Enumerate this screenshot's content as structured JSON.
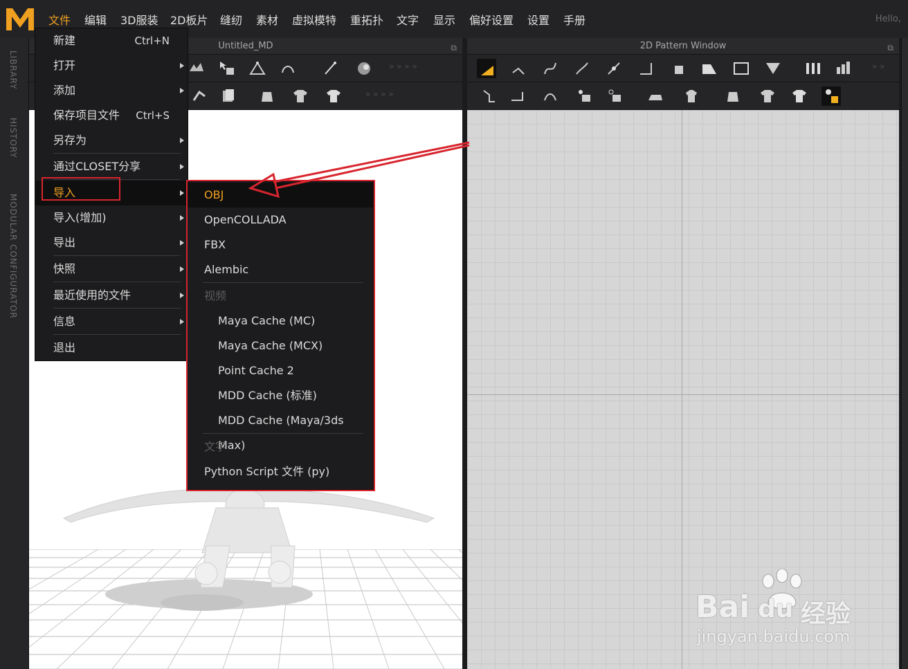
{
  "menubar": {
    "items": [
      "文件",
      "编辑",
      "3D服装",
      "2D板片",
      "缝纫",
      "素材",
      "虚拟模特",
      "重拓扑",
      "文字",
      "显示",
      "偏好设置",
      "设置",
      "手册"
    ],
    "hello": "Hello,"
  },
  "side_tabs": [
    "LIBRARY",
    "HISTORY",
    "MODULAR CONFIGURATOR"
  ],
  "panels": {
    "left_title": "Untitled_MD",
    "right_title": "2D Pattern Window"
  },
  "file_menu": {
    "items": [
      {
        "label": "新建",
        "shortcut": "Ctrl+N"
      },
      {
        "label": "打开",
        "submenu": true
      },
      {
        "label": "添加",
        "submenu": true
      },
      {
        "label": "保存项目文件",
        "shortcut": "Ctrl+S"
      },
      {
        "label": "另存为",
        "submenu": true
      },
      {
        "label": "通过CLOSET分享",
        "submenu": true
      },
      {
        "label": "导入",
        "submenu": true,
        "highlighted": true
      },
      {
        "label": "导入(增加)",
        "submenu": true
      },
      {
        "label": "导出",
        "submenu": true
      },
      {
        "label": "快照",
        "submenu": true
      },
      {
        "label": "最近使用的文件",
        "submenu": true
      },
      {
        "label": "信息",
        "submenu": true
      },
      {
        "label": "退出"
      }
    ]
  },
  "import_submenu": {
    "items": [
      {
        "label": "OBJ",
        "highlighted": true
      },
      {
        "label": "OpenCOLLADA"
      },
      {
        "label": "FBX"
      },
      {
        "label": "Alembic"
      },
      {
        "label": "视频",
        "group": true
      },
      {
        "label": "Maya Cache (MC)",
        "indent": true
      },
      {
        "label": "Maya Cache (MCX)",
        "indent": true
      },
      {
        "label": "Point Cache 2",
        "indent": true
      },
      {
        "label": "MDD Cache (标准)",
        "indent": true
      },
      {
        "label": "MDD Cache (Maya/3ds Max)",
        "indent": true
      },
      {
        "label": "文字",
        "group": true
      },
      {
        "label": "Python  Script 文件 (py)"
      }
    ]
  },
  "watermark": {
    "brand": "Bai",
    "brand2": "du",
    "suffix": "经验",
    "url": "jingyan.baidu.com"
  },
  "colors": {
    "accent": "#f0a020",
    "annotation": "#d8252e",
    "menu_bg": "#1c1c1e"
  }
}
